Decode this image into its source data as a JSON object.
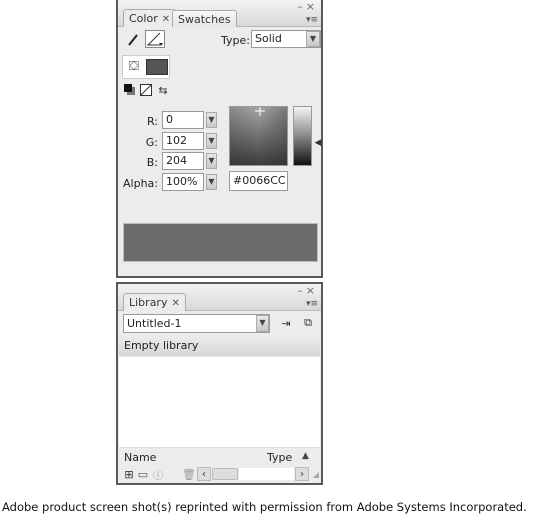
{
  "color_panel": {
    "tabs": [
      {
        "label": "Color",
        "active": true,
        "closable": true
      },
      {
        "label": "Swatches",
        "active": false,
        "closable": false
      }
    ],
    "window_controls": {
      "minimize": "–",
      "close": "×"
    },
    "menu_icon": "▾≡",
    "stroke_icon": "pencil-icon",
    "fill_icon": "paint-bucket-icon",
    "type_label": "Type:",
    "type_value": "Solid",
    "r_label": "R:",
    "r_value": "0",
    "g_label": "G:",
    "g_value": "102",
    "b_label": "B:",
    "b_value": "204",
    "alpha_label": "Alpha:",
    "alpha_value": "100%",
    "hex_value": "#0066CC",
    "selected_color": "#0066CC"
  },
  "library_panel": {
    "tabs": [
      {
        "label": "Library",
        "active": true,
        "closable": true
      }
    ],
    "window_controls": {
      "minimize": "–",
      "close": "×"
    },
    "menu_icon": "▾≡",
    "document_select": "Untitled-1",
    "status_text": "Empty library",
    "columns": [
      {
        "label": "Name"
      },
      {
        "label": "Type"
      }
    ],
    "sort_indicator": "▲"
  },
  "caption": "Adobe product screen shot(s) reprinted with permission from Adobe Systems Incorporated."
}
